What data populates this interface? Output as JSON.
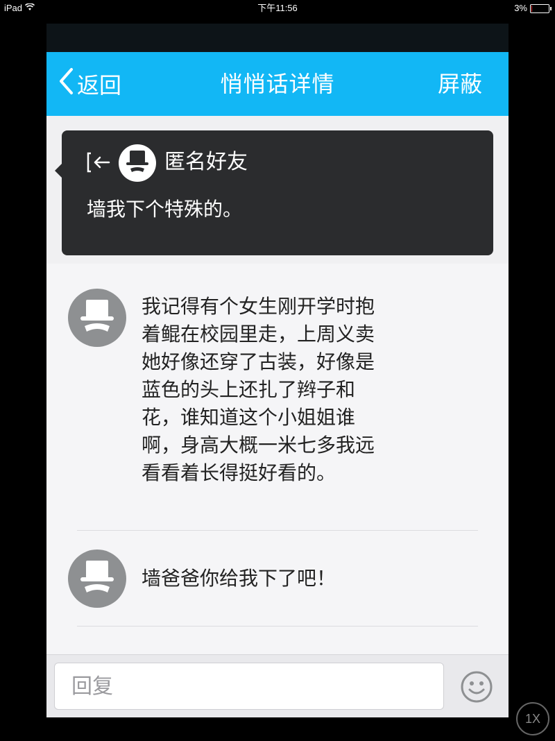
{
  "status_bar": {
    "device": "iPad",
    "time": "下午11:56",
    "battery": "3%",
    "battery_level": 0.03
  },
  "navbar": {
    "back_label": "返回",
    "title": "悄悄话详情",
    "right_action": "屏蔽"
  },
  "post": {
    "author": "匿名好友",
    "text": "墙我下个特殊的。"
  },
  "replies": [
    {
      "lines": [
        "我记得有个女生刚开学时抱",
        "着鲲在校园里走，上周义卖",
        "她好像还穿了古装，好像是",
        "蓝色的头上还扎了辫子和",
        "花，谁知道这个小姐姐谁",
        "啊，身高大概一米七多我远",
        "看看着长得挺好看的。"
      ]
    },
    {
      "lines": [
        "墙爸爸你给我下了吧！"
      ]
    }
  ],
  "input": {
    "placeholder": "回复"
  },
  "zoom": {
    "label": "1X"
  },
  "colors": {
    "navbar": "#12b7f5",
    "post_card": "#2b2c2e",
    "avatar_gray": "#8e9092",
    "background": "#f5f5f7"
  }
}
